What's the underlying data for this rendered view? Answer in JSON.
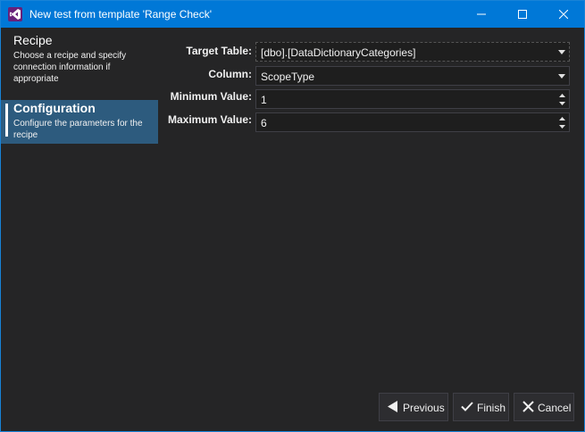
{
  "window": {
    "title": "New test from template 'Range Check'",
    "icon": "visual-studio-icon"
  },
  "sidebar": {
    "steps": [
      {
        "title": "Recipe",
        "description": "Choose a recipe and specify connection information if appropriate",
        "active": false
      },
      {
        "title": "Configuration",
        "description": "Configure the parameters for the recipe",
        "active": true
      }
    ]
  },
  "form": {
    "target_table": {
      "label": "Target Table:",
      "value": "[dbo].[DataDictionaryCategories]"
    },
    "column": {
      "label": "Column:",
      "value": "ScopeType"
    },
    "minimum_value": {
      "label": "Minimum Value:",
      "value": "1"
    },
    "maximum_value": {
      "label": "Maximum Value:",
      "value": "6"
    }
  },
  "buttons": {
    "previous": "Previous",
    "finish": "Finish",
    "cancel": "Cancel"
  },
  "colors": {
    "titlebar": "#0078d7",
    "background": "#252526",
    "active_step": "#2d5b7e",
    "field_background": "#1e1e1e"
  }
}
